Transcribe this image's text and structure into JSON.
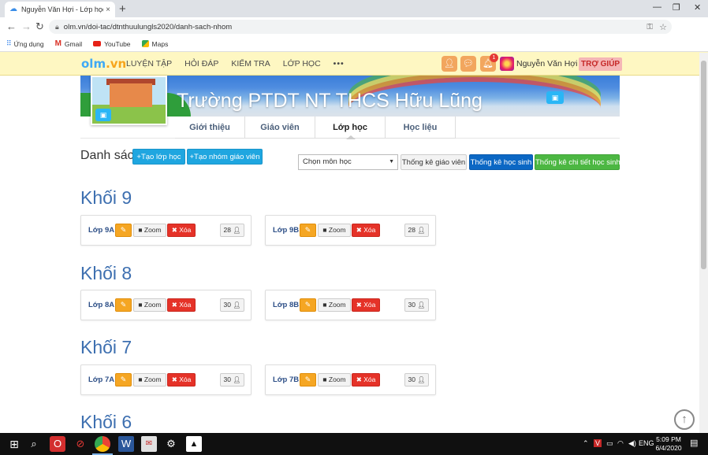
{
  "browser": {
    "tab_title": "Nguyễn Văn Hợi - Lớp học trực tu",
    "tab_close": "×",
    "new_tab": "+",
    "url": "olm.vn/doi-tac/dtnthuulungls2020/danh-sach-nhom",
    "bookmarks": [
      {
        "label": "Ứng dụng",
        "icon": "apps-icon"
      },
      {
        "label": "Gmail",
        "icon": "gmail-icon"
      },
      {
        "label": "YouTube",
        "icon": "youtube-icon"
      },
      {
        "label": "Maps",
        "icon": "maps-icon"
      }
    ]
  },
  "header": {
    "logo_part1": "olm",
    "logo_part2": ".vn",
    "nav": [
      "LUYỆN TẬP",
      "HỎI ĐÁP",
      "KIỂM TRA",
      "LỚP HỌC",
      "•••"
    ],
    "notification_count": "1",
    "username": "Nguyễn Văn Hợi ▾",
    "help": "TRỢ GIÚP"
  },
  "school": {
    "name": "Trường PTDT NT THCS Hữu Lũng"
  },
  "subtabs": [
    "Giới thiệu",
    "Giáo viên",
    "Lớp học",
    "Học liệu"
  ],
  "toolbar": {
    "title": "Danh sách",
    "create_class": "+Tạo lớp học",
    "create_teacher_group": "+Tạo nhóm giáo viên",
    "subject_select": "Chọn môn học",
    "teacher_stats": "Thống kê giáo viên",
    "student_stats": "Thống kê học sinh",
    "student_detail_stats": "Thống kê chi tiết học sinh"
  },
  "card_labels": {
    "zoom": "Zoom",
    "delete": "Xóa"
  },
  "grades": [
    {
      "title": "Khối 9",
      "classes": [
        {
          "name": "Lớp 9A",
          "count": "28"
        },
        {
          "name": "Lớp 9B",
          "count": "28"
        }
      ]
    },
    {
      "title": "Khối 8",
      "classes": [
        {
          "name": "Lớp 8A",
          "count": "30"
        },
        {
          "name": "Lớp 8B",
          "count": "30"
        }
      ]
    },
    {
      "title": "Khối 7",
      "classes": [
        {
          "name": "Lớp 7A",
          "count": "30"
        },
        {
          "name": "Lớp 7B",
          "count": "30"
        }
      ]
    },
    {
      "title": "Khối 6",
      "classes": []
    }
  ],
  "taskbar": {
    "lang": "ENG",
    "time": "5:09 PM",
    "date": "6/4/2020"
  }
}
